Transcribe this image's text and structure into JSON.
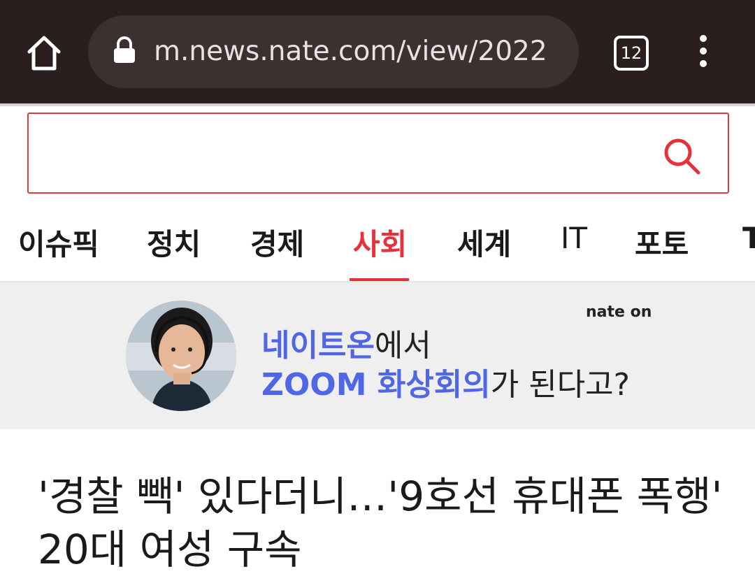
{
  "browser": {
    "url": "m.news.nate.com/view/2022",
    "tab_count": "12"
  },
  "search": {
    "placeholder": ""
  },
  "nav": {
    "items": [
      {
        "label": "이슈픽"
      },
      {
        "label": "정치"
      },
      {
        "label": "경제"
      },
      {
        "label": "사회"
      },
      {
        "label": "세계"
      },
      {
        "label": "IT"
      },
      {
        "label": "포토"
      },
      {
        "label": "T"
      }
    ],
    "active": "사회"
  },
  "banner": {
    "logo": "nate on",
    "line1_highlight": "네이트온",
    "line1_rest": "에서",
    "line2_highlight": "ZOOM 화상회의",
    "line2_rest": "가 된다고?"
  },
  "article": {
    "headline": "'경찰 빽' 있다더니…'9호선 휴대폰 폭행' 20대 여성 구속"
  },
  "colors": {
    "accent": "#e8303a",
    "chrome": "#2a1e1f",
    "banner_highlight": "#4f67e6"
  }
}
